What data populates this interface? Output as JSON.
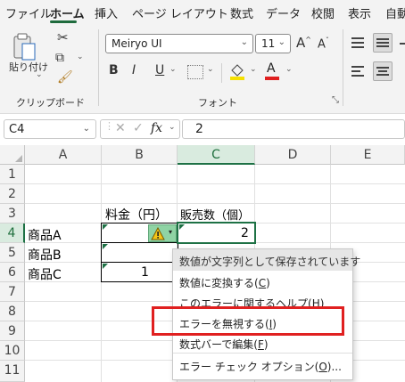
{
  "menu": {
    "tabs": [
      "ファイル",
      "ホーム",
      "挿入",
      "ページ レイアウト",
      "数式",
      "データ",
      "校閲",
      "表示",
      "自動"
    ],
    "active": "ホーム"
  },
  "ribbon": {
    "paste_label": "貼り付け",
    "clipboard_label": "クリップボード",
    "font_group_label": "フォント",
    "font_name": "Meiryo UI",
    "font_size": "11",
    "font_grow": "A",
    "font_shrink": "A",
    "bold": "B",
    "italic": "I",
    "underline": "U",
    "font_color_glyph": "A",
    "font_color": "#e02020",
    "fill_color": "#f5e000"
  },
  "formula_bar": {
    "name_box": "C4",
    "fx": "fx",
    "value": "2"
  },
  "grid": {
    "columns": [
      "A",
      "B",
      "C",
      "D",
      "E"
    ],
    "rows": [
      "1",
      "2",
      "3",
      "4",
      "5",
      "6",
      "7",
      "8",
      "9",
      "10",
      "11"
    ],
    "selected_column": "C",
    "selected_row": "4",
    "cells": {
      "B3": "料金（円）",
      "C3": "販売数（個）",
      "A4": "商品A",
      "A5": "商品B",
      "A6": "商品C",
      "C4": "2",
      "B6": "1"
    }
  },
  "error_menu": {
    "header": "数値が文字列として保存されています",
    "items": [
      {
        "text": "数値に変換する(",
        "key": "C",
        "end": ")"
      },
      {
        "text": "このエラーに関するヘルプ(",
        "key": "H",
        "end": ")"
      },
      {
        "text": "エラーを無視する(",
        "key": "I",
        "end": ")"
      },
      {
        "text": "数式バーで編集(",
        "key": "F",
        "end": ")"
      },
      {
        "text": "エラー チェック オプション(",
        "key": "O",
        "end": ")..."
      }
    ],
    "highlight_color": "#e02020"
  }
}
